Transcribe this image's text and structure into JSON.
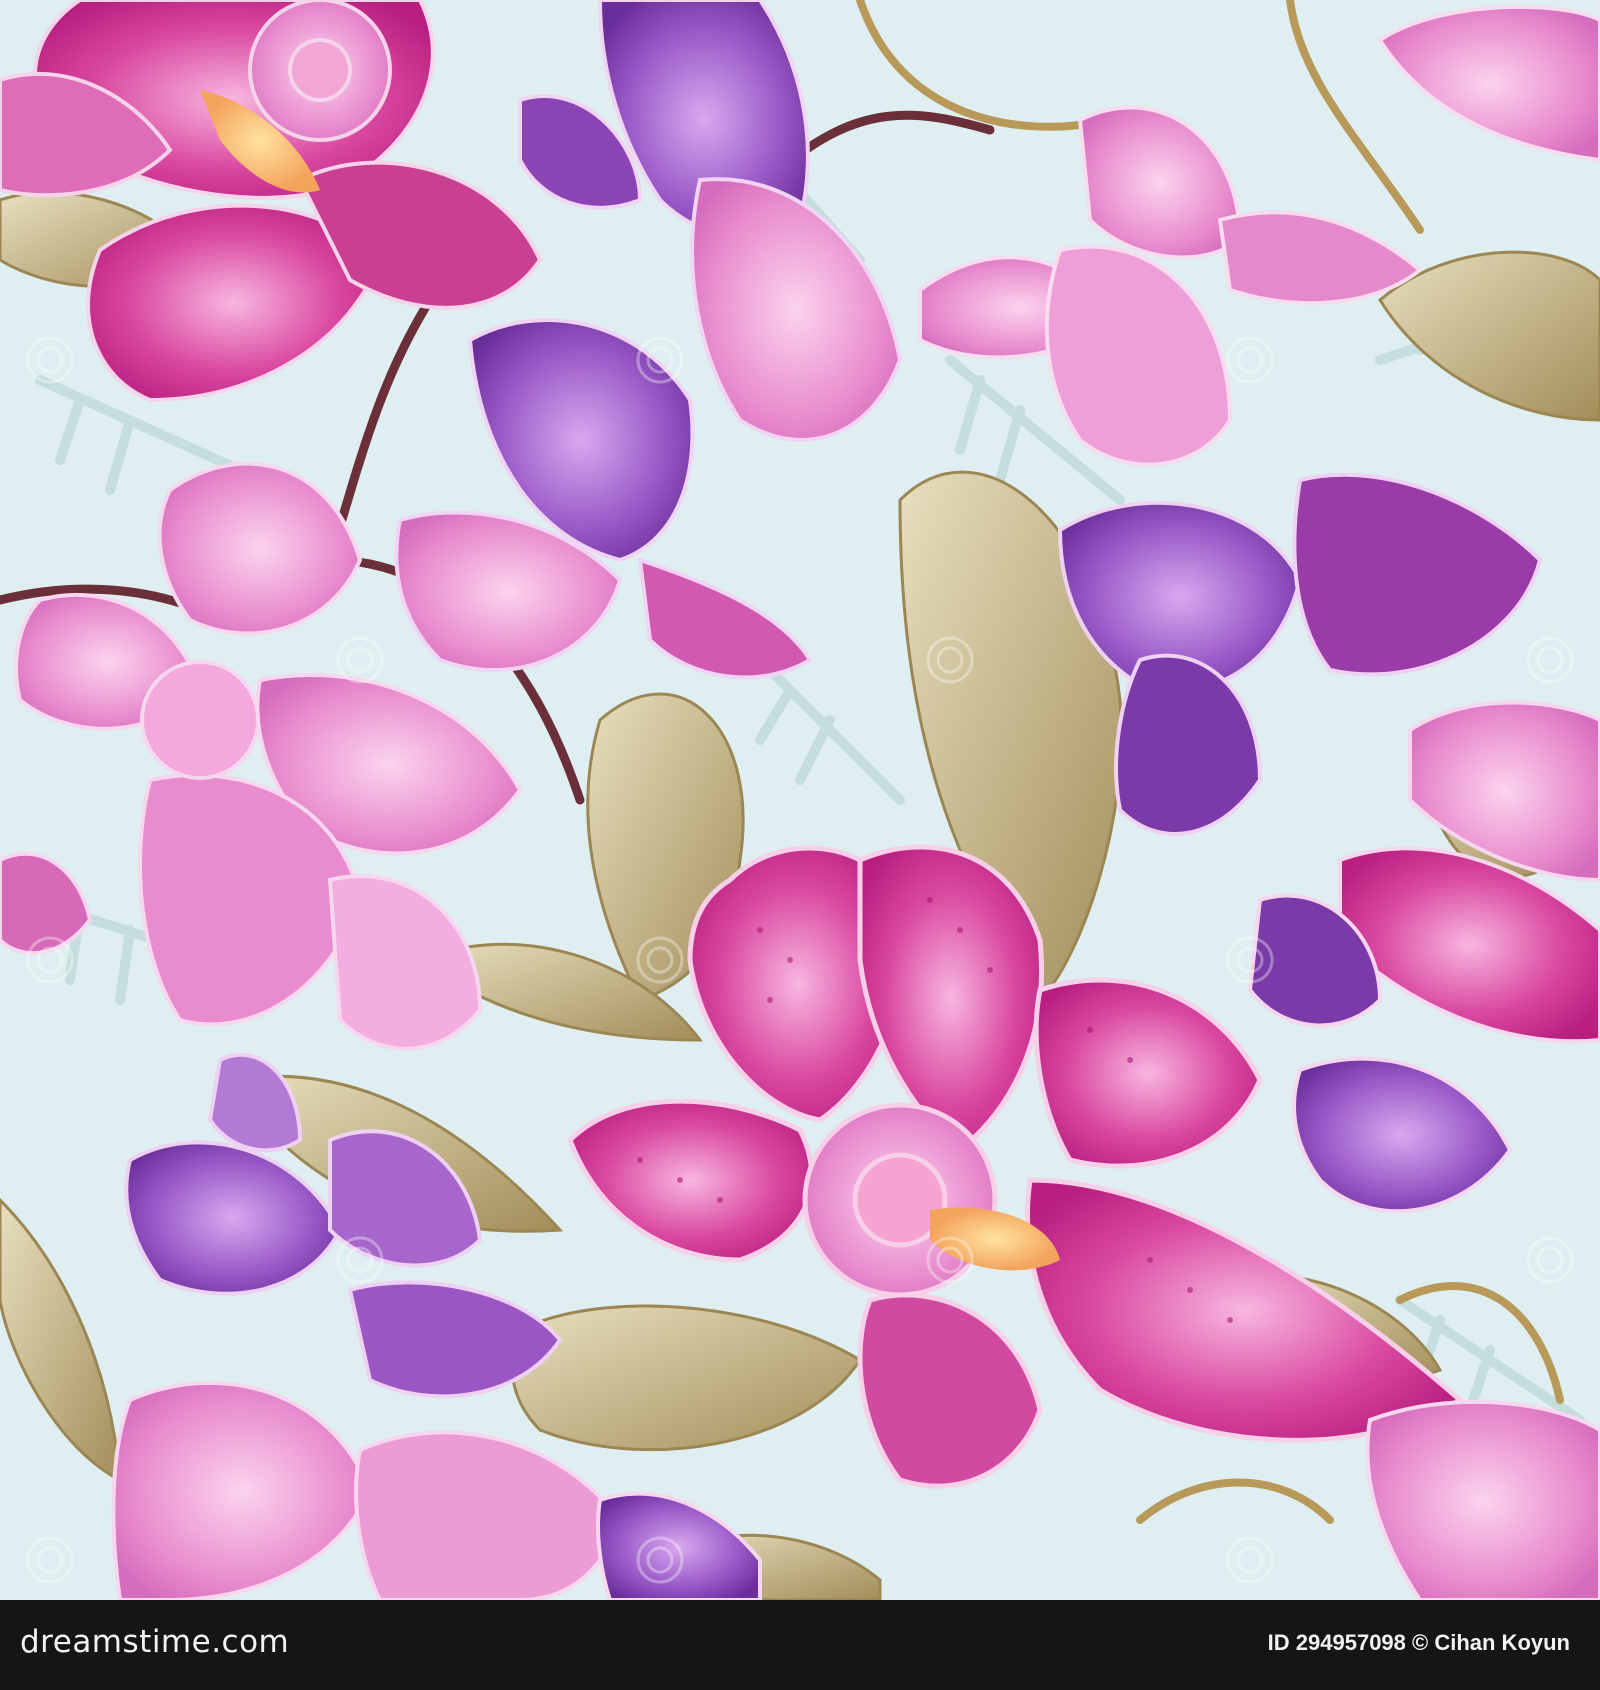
{
  "image": {
    "subject": "seamless floral pattern",
    "palette": {
      "background": "#dfeef0",
      "magenta": "#d0389a",
      "pink": "#e58ccb",
      "violet": "#8b4fb8",
      "olive_leaf": "#b9a77a",
      "stem": "#6b2f3a",
      "throat": "#f4b36a"
    }
  },
  "watermark": {
    "text": "dreamstime",
    "icon": "dreamstime-spiral-logo"
  },
  "footer": {
    "logo_text": "dreamstime.com",
    "credit": "ID 294957098 © Cihan Koyun"
  }
}
